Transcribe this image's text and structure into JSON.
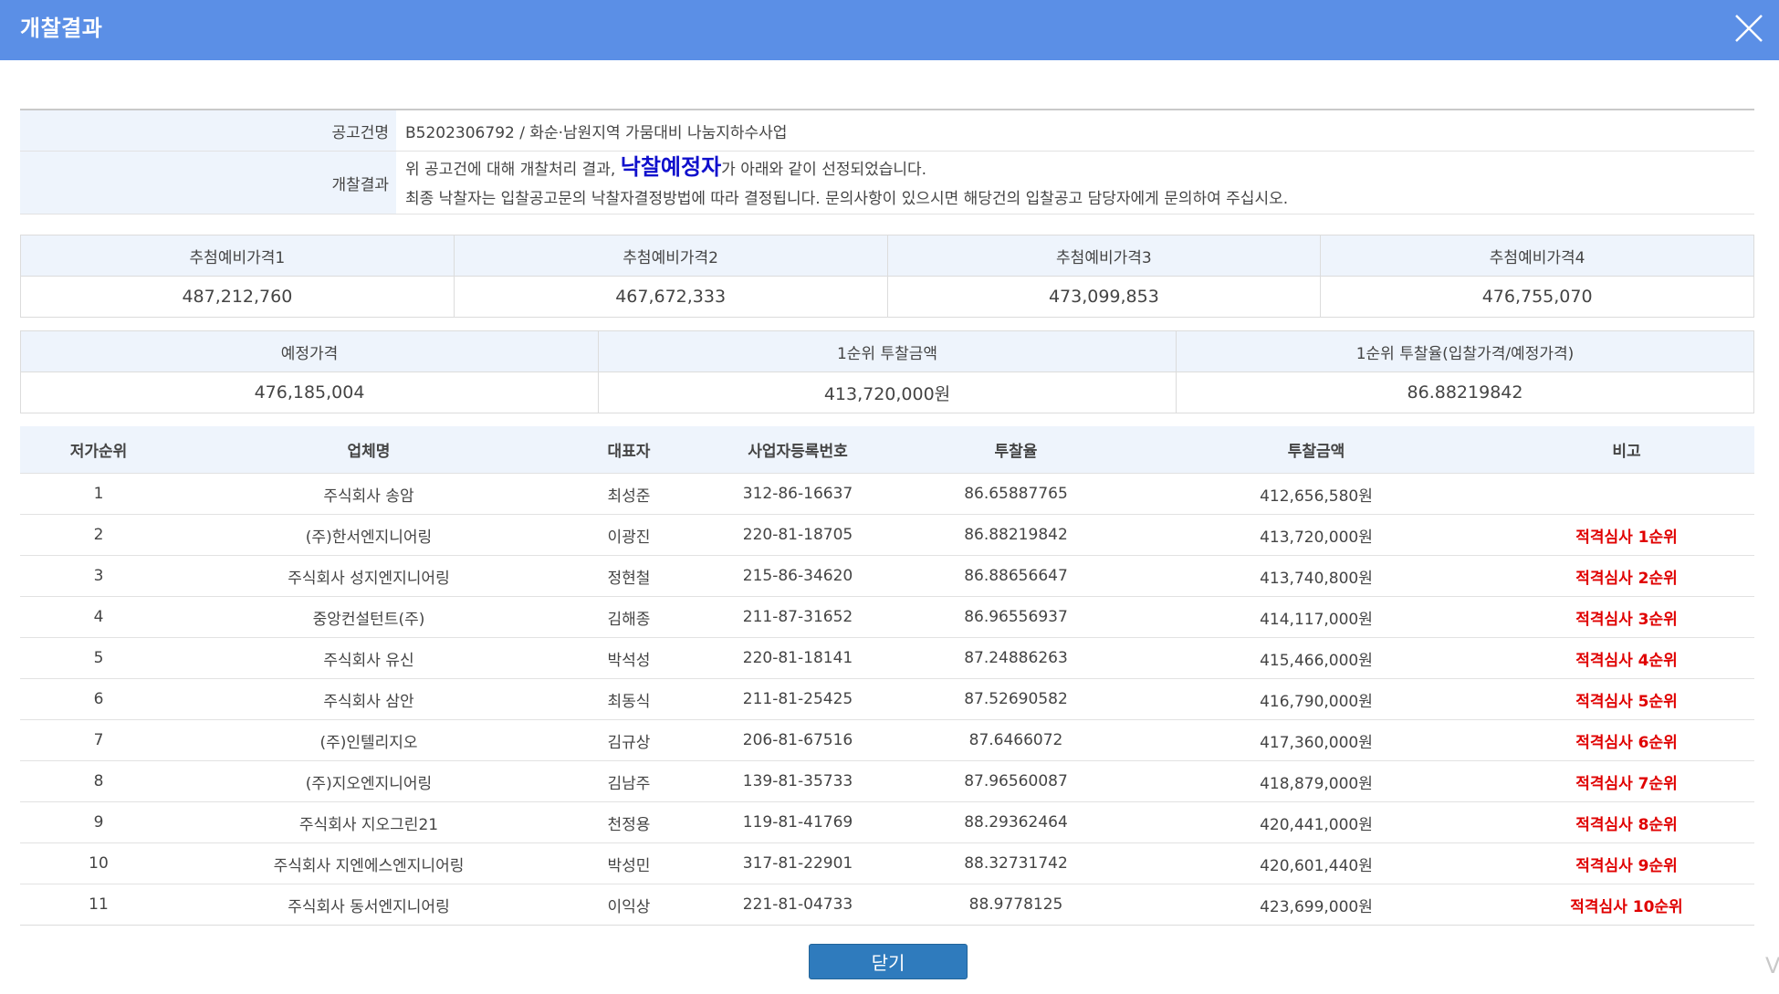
{
  "window": {
    "title": "개찰결과"
  },
  "notice": {
    "label": "공고건명",
    "value": "B5202306792 / 화순·남원지역 가뭄대비 나눔지하수사업",
    "result_label": "개찰결과",
    "line1_before": "위 공고건에 대해 개찰처리 결과, ",
    "line1_highlight": "낙찰예정자",
    "line1_after": "가 아래와 같이 선정되었습니다.",
    "line2": "최종 낙찰자는 입찰공고문의 낙찰자결정방법에 따라 결정됩니다. 문의사항이 있으시면 해당건의 입찰공고 담당자에게 문의하여 주십시오."
  },
  "prelim_prices": {
    "headers": [
      "추첨예비가격1",
      "추첨예비가격2",
      "추첨예비가격3",
      "추첨예비가격4"
    ],
    "values": [
      "487,212,760",
      "467,672,333",
      "473,099,853",
      "476,755,070"
    ]
  },
  "summary": {
    "headers": [
      "예정가격",
      "1순위 투찰금액",
      "1순위 투찰율(입찰가격/예정가격)"
    ],
    "values": [
      "476,185,004",
      "413,720,000원",
      "86.88219842"
    ]
  },
  "results": {
    "headers": [
      "저가순위",
      "업체명",
      "대표자",
      "사업자등록번호",
      "투찰율",
      "투찰금액",
      "비고"
    ],
    "rows": [
      [
        "1",
        "주식회사 송암",
        "최성준",
        "312-86-16637",
        "86.65887765",
        "412,656,580원",
        ""
      ],
      [
        "2",
        "(주)한서엔지니어링",
        "이광진",
        "220-81-18705",
        "86.88219842",
        "413,720,000원",
        "적격심사 1순위"
      ],
      [
        "3",
        "주식회사 성지엔지니어링",
        "정현철",
        "215-86-34620",
        "86.88656647",
        "413,740,800원",
        "적격심사 2순위"
      ],
      [
        "4",
        "중앙컨설턴트(주)",
        "김해종",
        "211-87-31652",
        "86.96556937",
        "414,117,000원",
        "적격심사 3순위"
      ],
      [
        "5",
        "주식회사 유신",
        "박석성",
        "220-81-18141",
        "87.24886263",
        "415,466,000원",
        "적격심사 4순위"
      ],
      [
        "6",
        "주식회사 삼안",
        "최동식",
        "211-81-25425",
        "87.52690582",
        "416,790,000원",
        "적격심사 5순위"
      ],
      [
        "7",
        "(주)인텔리지오",
        "김규상",
        "206-81-67516",
        "87.6466072",
        "417,360,000원",
        "적격심사 6순위"
      ],
      [
        "8",
        "(주)지오엔지니어링",
        "김남주",
        "139-81-35733",
        "87.96560087",
        "418,879,000원",
        "적격심사 7순위"
      ],
      [
        "9",
        "주식회사 지오그린21",
        "천정용",
        "119-81-41769",
        "88.29362464",
        "420,441,000원",
        "적격심사 8순위"
      ],
      [
        "10",
        "주식회사 지엔에스엔지니어링",
        "박성민",
        "317-81-22901",
        "88.32731742",
        "420,601,440원",
        "적격심사 9순위"
      ],
      [
        "11",
        "주식회사 동서엔지니어링",
        "이익상",
        "221-81-04733",
        "88.9778125",
        "423,699,000원",
        "적격심사 10순위"
      ]
    ]
  },
  "footer": {
    "close_label": "닫기",
    "corner_glyph": "V"
  },
  "icons": {
    "close": "close-icon"
  },
  "colors": {
    "titlebar": "#5b8fe6",
    "highlight": "#1010cc",
    "note": "#e00000",
    "button": "#2f7bbd"
  }
}
